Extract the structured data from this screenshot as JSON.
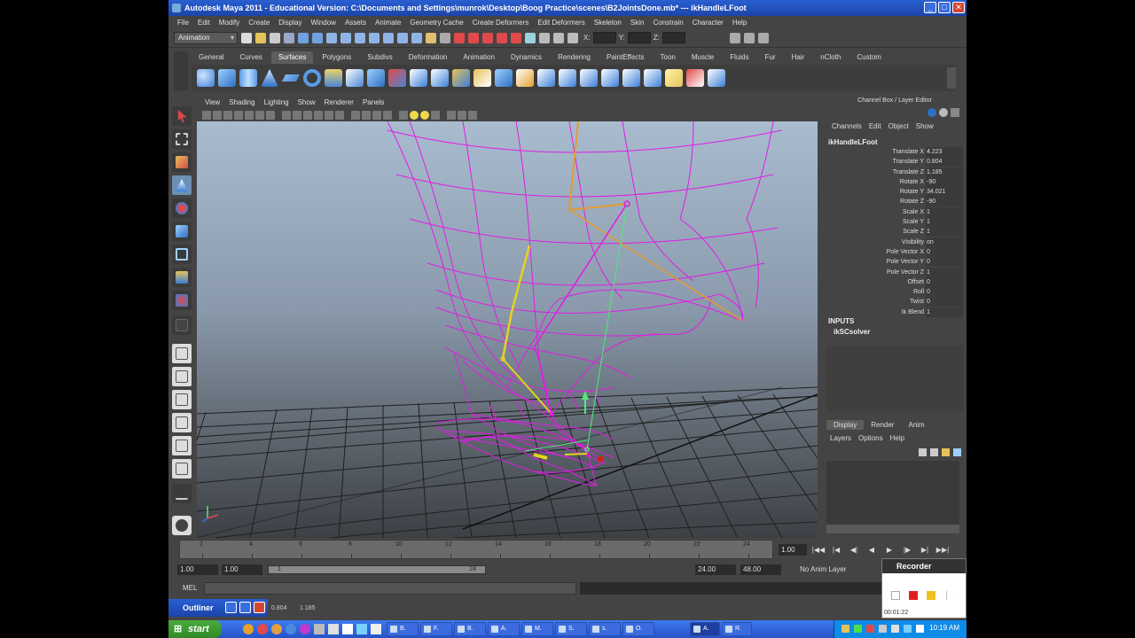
{
  "window": {
    "title": "Autodesk Maya 2011 - Educational Version: C:\\Documents and Settings\\munrok\\Desktop\\Boog Practice\\scenes\\B2JointsDone.mb*   ---   ikHandleLFoot",
    "min_label": "_",
    "max_label": "□",
    "close_label": "✕"
  },
  "menubar": [
    "File",
    "Edit",
    "Modify",
    "Create",
    "Display",
    "Window",
    "Assets",
    "Animate",
    "Geometry Cache",
    "Create Deformers",
    "Edit Deformers",
    "Skeleton",
    "Skin",
    "Constrain",
    "Character",
    "Help"
  ],
  "statusline": {
    "mode": "Animation",
    "x_label": "X:",
    "y_label": "Y:",
    "z_label": "Z:"
  },
  "shelf": {
    "tabs": [
      "General",
      "Curves",
      "Surfaces",
      "Polygons",
      "Subdivs",
      "Deformation",
      "Animation",
      "Dynamics",
      "Rendering",
      "PaintEffects",
      "Toon",
      "Muscle",
      "Fluids",
      "Fur",
      "Hair",
      "nCloth",
      "Custom"
    ],
    "active_tab": "Surfaces"
  },
  "viewport": {
    "menu": [
      "View",
      "Shading",
      "Lighting",
      "Show",
      "Renderer",
      "Panels"
    ]
  },
  "timeline": {
    "ticks": [
      "2",
      "4",
      "6",
      "8",
      "10",
      "12",
      "14",
      "16",
      "18",
      "20",
      "22",
      "24"
    ],
    "current": "1.00"
  },
  "range": {
    "start": "1.00",
    "start2": "1.00",
    "slider_left": "1",
    "slider_right": "24",
    "end": "24.00",
    "end2": "48.00",
    "anim_layer": "No Anim Layer"
  },
  "cmdline": {
    "label": "MEL"
  },
  "channelbox": {
    "title": "Channel Box / Layer Editor",
    "menu": [
      "Channels",
      "Edit",
      "Object",
      "Show"
    ],
    "node": "ikHandleLFoot",
    "attributes": [
      {
        "name": "Translate X",
        "value": "4.223"
      },
      {
        "name": "Translate Y",
        "value": "0.804"
      },
      {
        "name": "Translate Z",
        "value": "1.185"
      },
      {
        "name": "Rotate X",
        "value": "-90"
      },
      {
        "name": "Rotate Y",
        "value": "34.021"
      },
      {
        "name": "Rotate Z",
        "value": "-90"
      },
      {
        "name": "Scale X",
        "value": "1"
      },
      {
        "name": "Scale Y",
        "value": "1"
      },
      {
        "name": "Scale Z",
        "value": "1"
      },
      {
        "name": "Visibility",
        "value": "on"
      },
      {
        "name": "Pole Vector X",
        "value": "0"
      },
      {
        "name": "Pole Vector Y",
        "value": "0"
      },
      {
        "name": "Pole Vector Z",
        "value": "1"
      },
      {
        "name": "Offset",
        "value": "0"
      },
      {
        "name": "Roll",
        "value": "0"
      },
      {
        "name": "Twist",
        "value": "0"
      },
      {
        "name": "Ik Blend",
        "value": "1"
      }
    ],
    "inputs_label": "INPUTS",
    "solver": "ikSCsolver"
  },
  "layereditor": {
    "tabs": [
      "Display",
      "Render",
      "Anim"
    ],
    "active_tab": "Display",
    "menu": [
      "Layers",
      "Options",
      "Help"
    ]
  },
  "outliner": {
    "title": "Outliner",
    "val1": "0.804",
    "val2": "1.185"
  },
  "recorder": {
    "title": "Recorder",
    "time": "00:01:22"
  },
  "taskbar": {
    "start": "start",
    "items": [
      "B.",
      "F.",
      "B.",
      "A.",
      "M.",
      "S.",
      "s.",
      "O.",
      "A.",
      "R."
    ],
    "clock": "10:19 AM"
  },
  "colors": {
    "wireframe": "#e21be6",
    "joint_yellow": "#e6d21e",
    "joint_orange": "#e69a30",
    "ik_green": "#53e87a",
    "title_blue": "#2a5fd1"
  }
}
